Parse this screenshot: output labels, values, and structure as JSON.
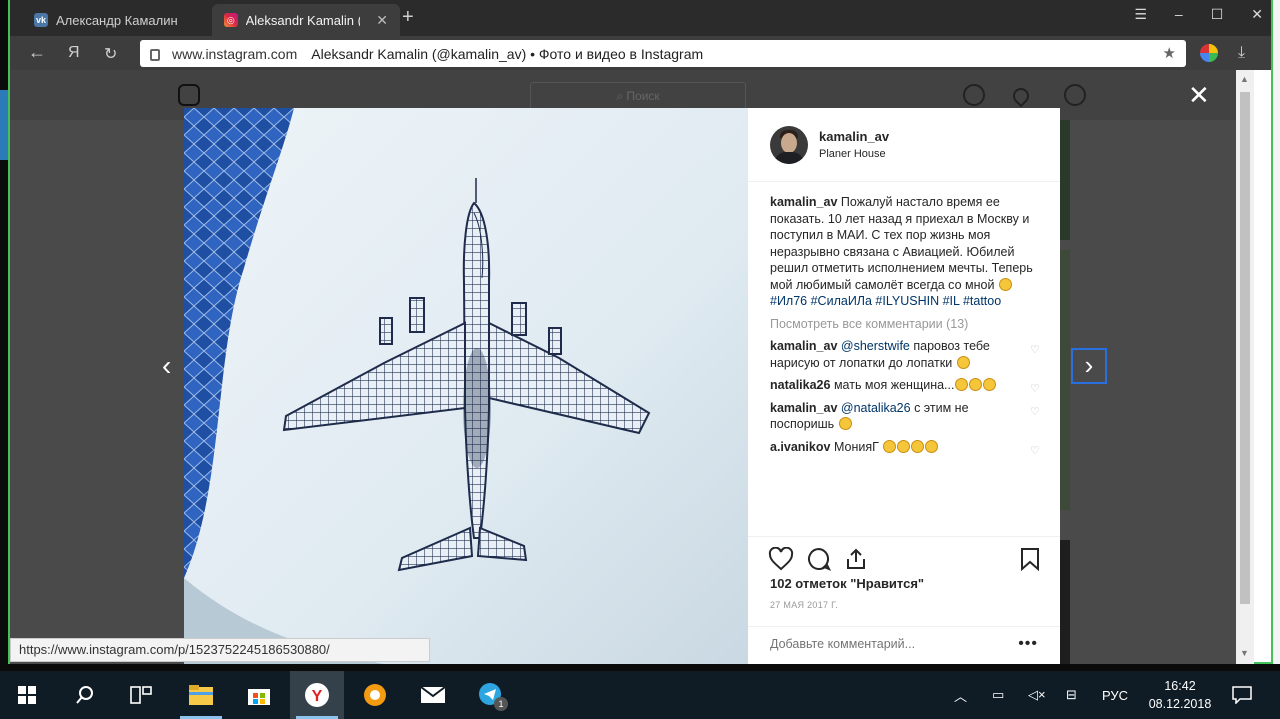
{
  "browser": {
    "tabs": [
      {
        "label": "Александр Камалин",
        "favicon": "vk-icon",
        "active": false
      },
      {
        "label": "Aleksandr Kamalin (@ka",
        "favicon": "instagram-icon",
        "active": true
      }
    ],
    "address_domain": "www.instagram.com",
    "address_title": "Aleksandr Kamalin (@kamalin_av) • Фото и видео в Instagram",
    "back_label": "←",
    "yandex_label": "Я",
    "status_url": "https://www.instagram.com/p/1523752245186530880/"
  },
  "instagram_bg": {
    "search_placeholder": "Поиск"
  },
  "post": {
    "username": "kamalin_av",
    "location": "Planer House",
    "caption_user": "kamalin_av",
    "caption_text": "Пожалуй настало время ее показать. 10 лет назад я приехал в Москву и поступил в МАИ. С тех пор жизнь моя неразрывно связана с Авиацией. Юбилей решил отметить исполнением мечты. Теперь мой любимый самолёт всегда со мной",
    "caption_tags": "#Ил76 #СилаИЛа #ILYUSHIN #IL #tattoo",
    "view_all": "Посмотреть все комментарии (13)",
    "comments": [
      {
        "user": "kamalin_av",
        "mention": "@sherstwife",
        "text": "паровоз тебе нарисую от лопатки до лопатки",
        "emojis": 1
      },
      {
        "user": "natalika26",
        "mention": "",
        "text": "мать моя женщина...",
        "emojis": 3
      },
      {
        "user": "kamalin_av",
        "mention": "@natalika26",
        "text": "с этим не поспоришь",
        "emojis": 1
      },
      {
        "user": "a.ivanikov",
        "mention": "",
        "text": "МонияГ",
        "emojis": 4
      }
    ],
    "likes": "102 отметок \"Нравится\"",
    "date": "27 МАЯ 2017 Г.",
    "add_comment_placeholder": "Добавьте комментарий...",
    "more": "•••"
  },
  "taskbar": {
    "language": "РУС",
    "time": "16:42",
    "date": "08.12.2018",
    "telegram_badge": "1"
  },
  "colors": {
    "accent_green": "#43c25a",
    "ig_link": "#003569",
    "taskbar": "#101c25"
  }
}
